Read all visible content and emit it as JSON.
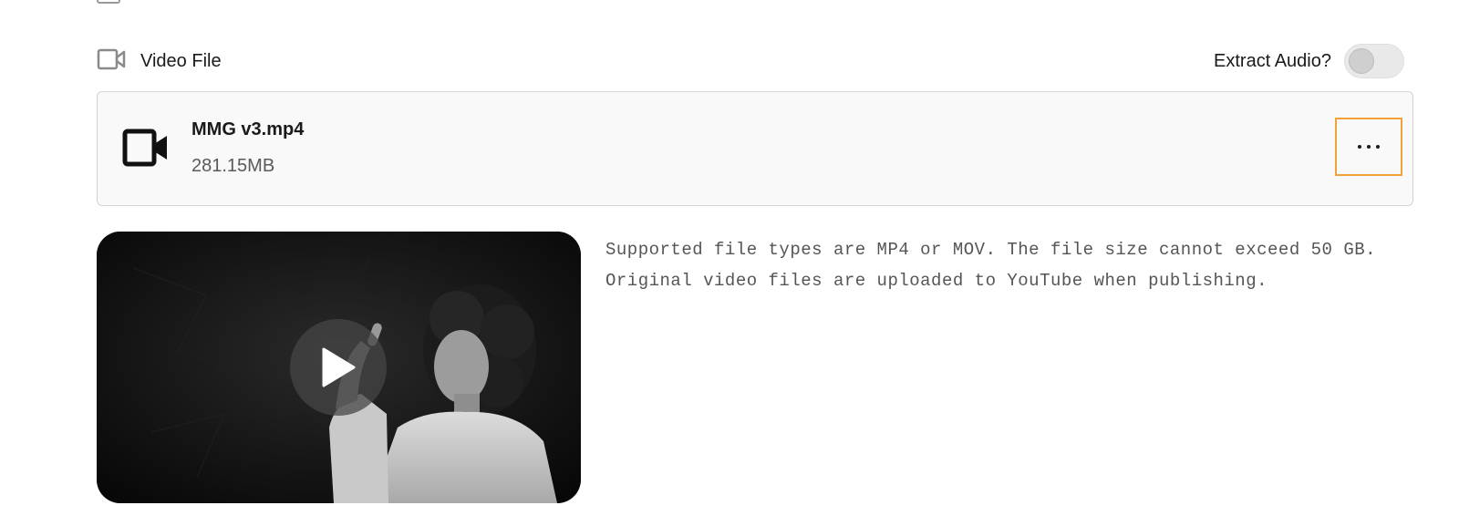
{
  "section": {
    "title": "Video File",
    "title_icon": "video-camera-outline-icon"
  },
  "extract_audio": {
    "label": "Extract Audio?",
    "enabled": false
  },
  "file": {
    "icon": "video-camera-icon",
    "name": "MMG v3.mp4",
    "size": "281.15MB",
    "menu_icon": "more-horizontal-icon"
  },
  "preview": {
    "play_icon": "play-icon",
    "image": "woman-pointing-thumbnail"
  },
  "help": {
    "line1": "Supported file types are MP4 or MOV. The file size cannot exceed 50 GB.",
    "line2": "Original video files are uploaded to YouTube when publishing."
  },
  "colors": {
    "focus_outline": "#f2a23a",
    "card_background": "#f9f9fa",
    "card_border": "#d4d4d8"
  }
}
